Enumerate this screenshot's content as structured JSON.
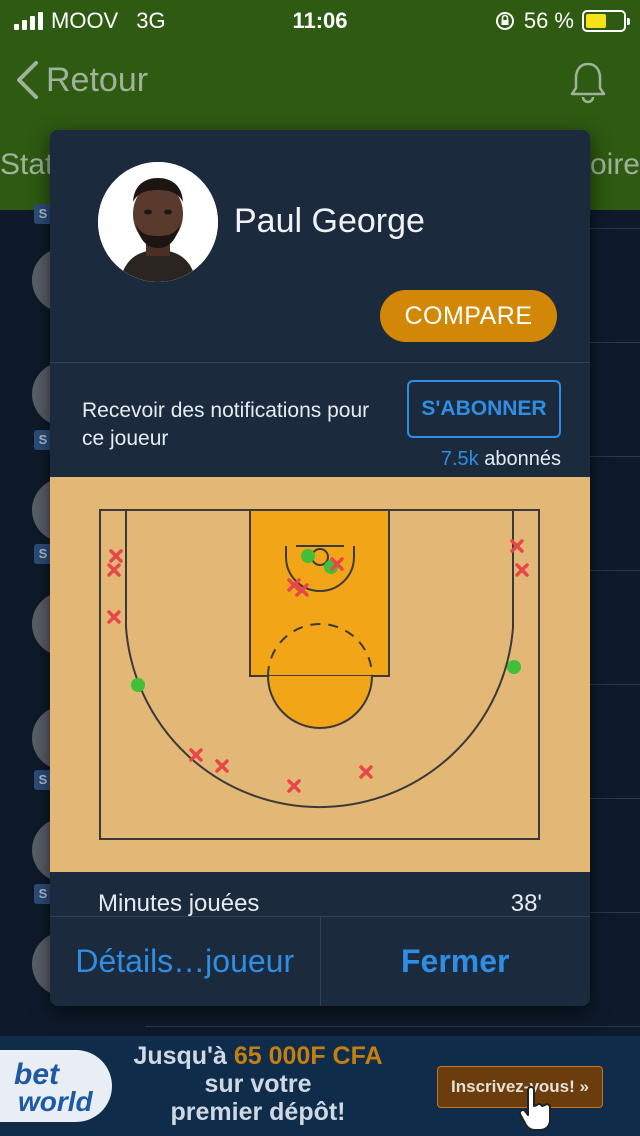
{
  "status_bar": {
    "carrier": "MOOV",
    "network": "3G",
    "time": "11:06",
    "battery_percent": "56 %",
    "battery_level": 0.56
  },
  "nav": {
    "back_label": "Retour",
    "tab_left": "Stat",
    "tab_right": "oire"
  },
  "player": {
    "name": "Paul George",
    "compare_label": "COMPARE"
  },
  "notifications": {
    "text": "Recevoir des notifications pour ce joueur",
    "subscribe_label": "S'ABONNER",
    "followers_count": "7.5k",
    "followers_label": "abonnés"
  },
  "shot_chart": {
    "made_color": "#3fbf3a",
    "missed_color": "#e8474a",
    "court_color": "#e3b877",
    "paint_color": "#f2a517"
  },
  "stats": [
    {
      "label": "Minutes jouées",
      "value": "38'"
    }
  ],
  "footer": {
    "details_label": "Détails…joueur",
    "close_label": "Fermer"
  },
  "ad": {
    "brand_line1": "bet",
    "brand_line2": "world",
    "line1_prefix": "Jusqu'à ",
    "amount": "65 000F CFA",
    "line2": "sur votre",
    "line3": "premier dépôt!",
    "cta_label": "Inscrivez-vous! »"
  }
}
